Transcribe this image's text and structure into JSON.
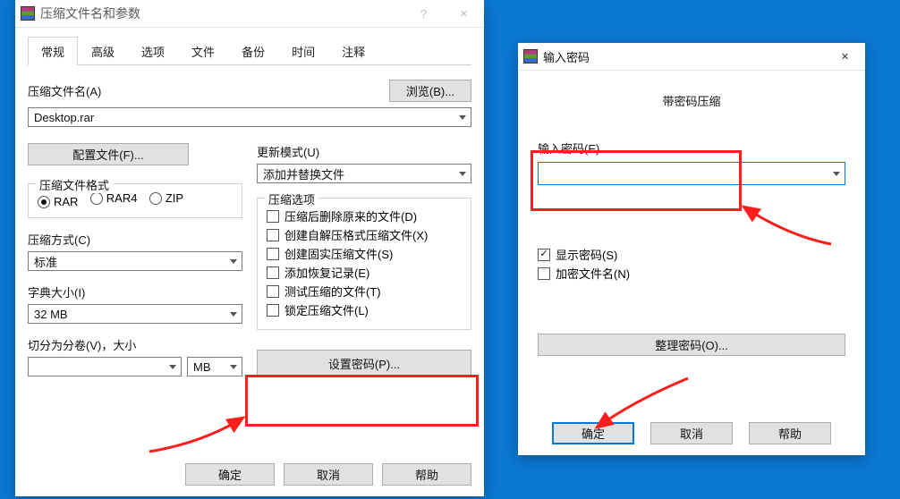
{
  "mainWin": {
    "title": "压缩文件名和参数",
    "tabs": [
      "常规",
      "高级",
      "选项",
      "文件",
      "备份",
      "时间",
      "注释"
    ],
    "archiveNameLabel": "压缩文件名(A)",
    "browseBtn": "浏览(B)...",
    "archiveName": "Desktop.rar",
    "profileBtn": "配置文件(F)...",
    "updateModeLabel": "更新模式(U)",
    "updateMode": "添加并替换文件",
    "formatLegend": "压缩文件格式",
    "formats": {
      "rar": "RAR",
      "rar4": "RAR4",
      "zip": "ZIP"
    },
    "methodLabel": "压缩方式(C)",
    "method": "标准",
    "dictLabel": "字典大小(I)",
    "dict": "32 MB",
    "splitLabel": "切分为分卷(V)，大小",
    "splitUnit": "MB",
    "optsLegend": "压缩选项",
    "opts": [
      "压缩后删除原来的文件(D)",
      "创建自解压格式压缩文件(X)",
      "创建固实压缩文件(S)",
      "添加恢复记录(E)",
      "测试压缩的文件(T)",
      "锁定压缩文件(L)"
    ],
    "setPwdBtn": "设置密码(P)...",
    "ok": "确定",
    "cancel": "取消",
    "help": "帮助"
  },
  "pwdWin": {
    "title": "输入密码",
    "heading": "带密码压缩",
    "enterLabel": "输入密码(E)",
    "showPwd": "显示密码(S)",
    "encryptNames": "加密文件名(N)",
    "organizeBtn": "整理密码(O)...",
    "ok": "确定",
    "cancel": "取消",
    "help": "帮助"
  }
}
